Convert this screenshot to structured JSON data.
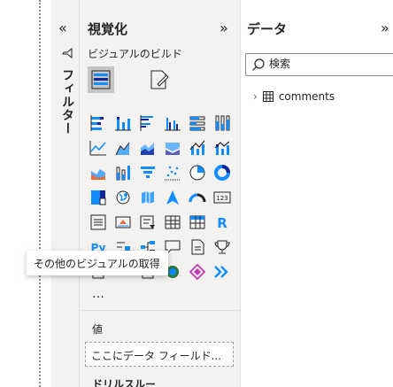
{
  "filters": {
    "collapse_icon": "«",
    "label": "フィルター"
  },
  "visualizations": {
    "title": "視覚化",
    "expand_icon": "»",
    "build_label": "ビジュアルのビルド",
    "more": "…",
    "values_label": "値",
    "values_placeholder": "ここにデータ フィールド...",
    "drill_label": "ドリルスルー",
    "tooltip": "その他のビジュアルの取得",
    "icons": [
      "stacked-bar-icon",
      "stacked-column-icon",
      "clustered-bar-icon",
      "clustered-column-icon",
      "100-stacked-bar-icon",
      "100-stacked-column-icon",
      "line-chart-icon",
      "area-chart-icon",
      "stacked-area-icon",
      "ribbon-chart-icon",
      "line-clustered-column-icon",
      "line-stacked-column-icon",
      "waterfall-icon",
      "funnel-chart-icon",
      "funnel-icon",
      "scatter-icon",
      "pie-chart-icon",
      "donut-chart-icon",
      "treemap-icon",
      "map-icon",
      "filled-map-icon",
      "azure-map-icon",
      "gauge-icon",
      "card-icon",
      "multi-row-card-icon",
      "kpi-icon",
      "slicer-icon",
      "table-icon",
      "matrix-icon",
      "r-visual-icon",
      "python-visual-icon",
      "key-influencers-icon",
      "decomposition-tree-icon",
      "qa-icon",
      "smart-narrative-icon",
      "goals-icon",
      "paginated-report-icon",
      "power-apps-icon",
      "power-automate-icon",
      "arcgis-icon",
      "diamond-icon",
      "chevrons-icon"
    ],
    "r_letter": "R",
    "py_letter": "Py",
    "card_text": "123"
  },
  "data": {
    "title": "データ",
    "expand_icon": "»",
    "search_placeholder": "検索",
    "tables": [
      {
        "name": "comments"
      }
    ]
  }
}
